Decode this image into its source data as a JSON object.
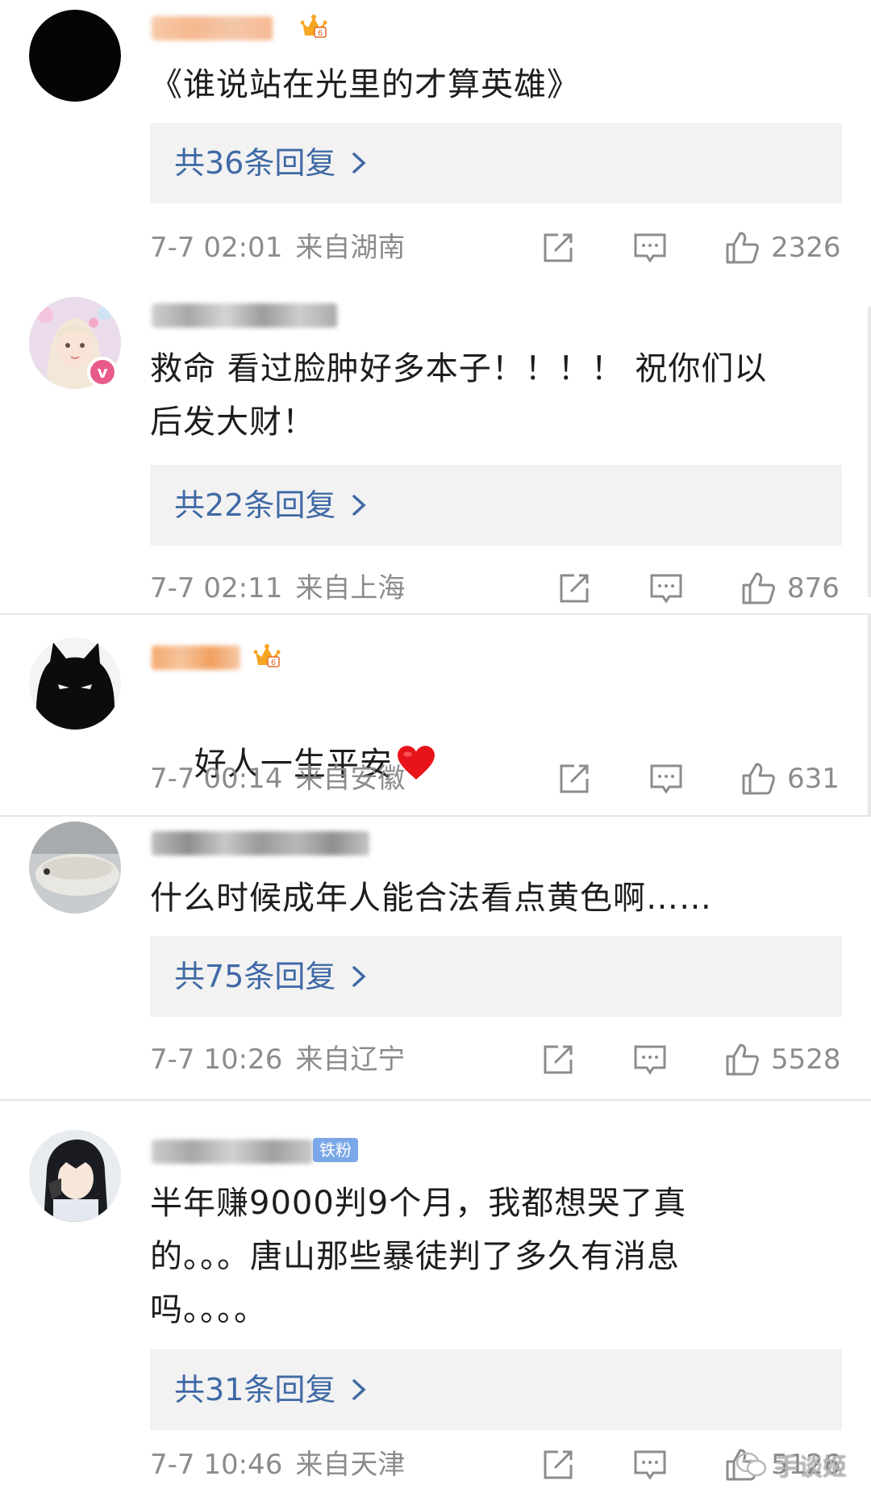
{
  "colors": {
    "link": "#3f69a5",
    "meta": "#8c8c8c",
    "reply_bg": "#f2f2f2",
    "vip_badge": "#e85a8a",
    "fan_badge": "#7aa7e6"
  },
  "comments": [
    {
      "avatar": "black-circle-avatar",
      "badge": "crown-icon",
      "text": "《谁说站在光里的才算英雄》",
      "reply_label": "共36条回复",
      "time": "7-7 02:01",
      "location": "来自湖南",
      "likes": "2326"
    },
    {
      "avatar": "girl-avatar",
      "badge": "v-icon",
      "text": "救命 看过脸肿好多本子！！！！ 祝你们以\n后发大财！",
      "reply_label": "共22条回复",
      "time": "7-7 02:11",
      "location": "来自上海",
      "likes": "876"
    },
    {
      "avatar": "black-cat-avatar",
      "badge": "crown-icon",
      "text": "好人一生平安",
      "emoji": "heart-icon",
      "time": "7-7 00:14",
      "location": "来自安徽",
      "likes": "631"
    },
    {
      "avatar": "fish-avatar",
      "text": "什么时候成年人能合法看点黄色啊……",
      "reply_label": "共75条回复",
      "time": "7-7 10:26",
      "location": "来自辽宁",
      "likes": "5528"
    },
    {
      "avatar": "anime-character-avatar",
      "badge_text": "铁粉",
      "text": "半年赚9000判9个月，我都想哭了真\n的。。。唐山那些暴徒判了多久有消息\n吗。。。。",
      "reply_label": "共31条回复",
      "time": "7-7 10:46",
      "location": "来自天津",
      "likes": "5126"
    }
  ],
  "watermark": {
    "icon": "wechat-icon",
    "text": "手谈姬"
  }
}
